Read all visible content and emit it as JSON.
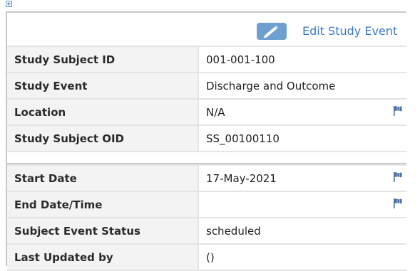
{
  "header": {
    "edit_label": "Edit Study Event"
  },
  "subject_rows": [
    {
      "label": "Study Subject ID",
      "value": "001-001-100",
      "flag": false
    },
    {
      "label": "Study Event",
      "value": "Discharge and Outcome",
      "flag": false
    },
    {
      "label": "Location",
      "value": "N/A",
      "flag": true
    },
    {
      "label": "Study Subject OID",
      "value": "SS_00100110",
      "flag": false
    }
  ],
  "event_rows": [
    {
      "label": "Start Date",
      "value": "17-May-2021",
      "flag": true
    },
    {
      "label": "End Date/Time",
      "value": "",
      "flag": true
    },
    {
      "label": "Subject Event Status",
      "value": "scheduled",
      "flag": false
    },
    {
      "label": "Last Updated by",
      "value": "()",
      "flag": false
    }
  ],
  "colors": {
    "link": "#3a79c4",
    "edit_icon_bg": "#6d9fd0",
    "flag": "#4a6fa5",
    "label_bg": "#f3f3f3"
  },
  "icons": {
    "expand": "plus-box-icon",
    "edit": "pencil-icon",
    "flag": "flag-icon"
  }
}
